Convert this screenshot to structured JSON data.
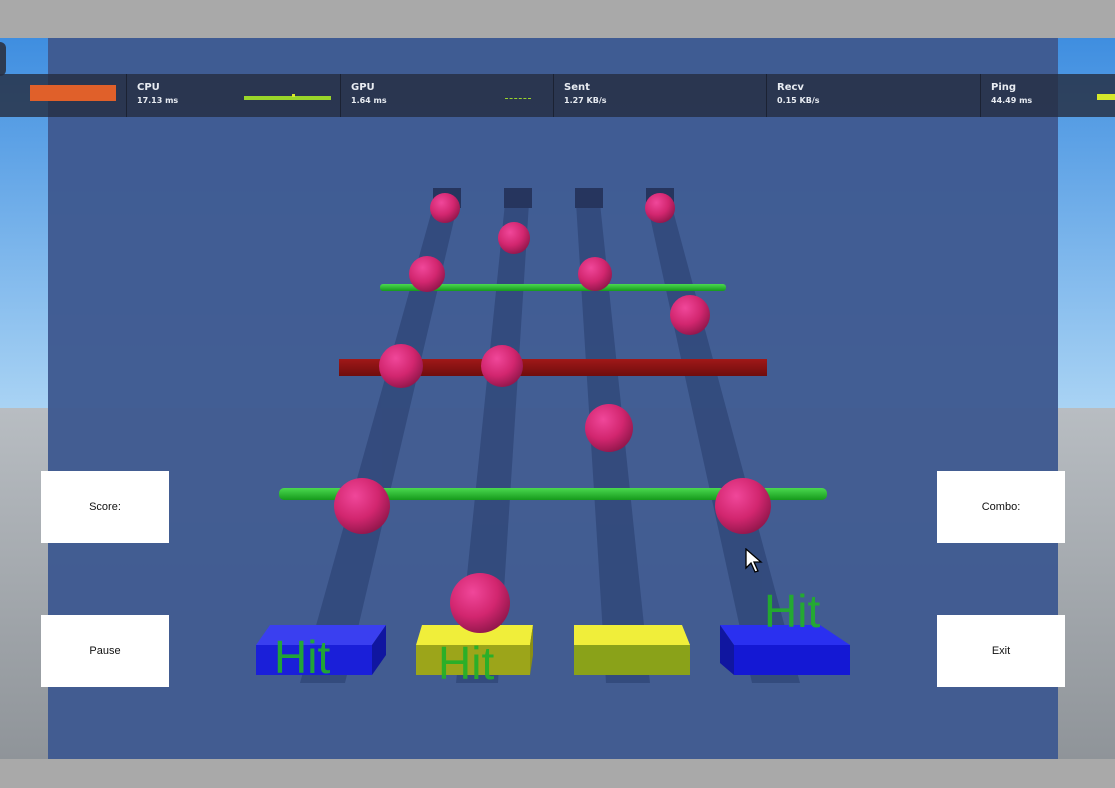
{
  "stats": {
    "cpu": {
      "label": "CPU",
      "value": "17.13 ms"
    },
    "gpu": {
      "label": "GPU",
      "value": "1.64 ms"
    },
    "sent": {
      "label": "Sent",
      "value": "1.27 KB/s"
    },
    "recv": {
      "label": "Recv",
      "value": "0.15 KB/s"
    },
    "ping": {
      "label": "Ping",
      "value": "44.49 ms"
    }
  },
  "hud": {
    "score_label": "Score:",
    "combo_label": "Combo:",
    "pause_label": "Pause",
    "exit_label": "Exit"
  },
  "hit_pads": [
    {
      "text": "Hit",
      "color": "#1a1fd9"
    },
    {
      "text": "Hit",
      "color": "#d6d41a"
    },
    {
      "text": "",
      "color": "#d6d41a"
    },
    {
      "text": "Hit",
      "color": "#1a1fd9"
    }
  ],
  "colors": {
    "overlay": "#3f5a91",
    "note": "#d2266f",
    "bar_green": "#22b02a",
    "bar_red": "#8a1111",
    "stat_bar": "#e0602a",
    "graph_green": "#9ad62a",
    "hit_text": "#22b02a"
  },
  "icons": [
    "mouse-cursor-icon"
  ]
}
